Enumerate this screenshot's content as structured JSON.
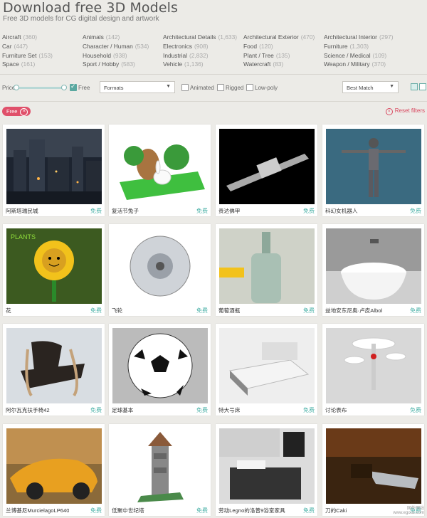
{
  "header": {
    "title": "Download free 3D Models",
    "subtitle": "Free 3D models for CG digital design and artwork"
  },
  "categories": [
    {
      "name": "Aircraft",
      "count": "(360)"
    },
    {
      "name": "Animals",
      "count": "(142)"
    },
    {
      "name": "Architectural Details",
      "count": "(1,633)"
    },
    {
      "name": "Architectural Exterior",
      "count": "(470)"
    },
    {
      "name": "Architectural Interior",
      "count": "(297)"
    },
    {
      "name": "Car",
      "count": "(447)"
    },
    {
      "name": "Character / Human",
      "count": "(534)"
    },
    {
      "name": "Electronics",
      "count": "(908)"
    },
    {
      "name": "Food",
      "count": "(120)"
    },
    {
      "name": "Furniture",
      "count": "(1,303)"
    },
    {
      "name": "Furniture Set",
      "count": "(153)"
    },
    {
      "name": "Household",
      "count": "(938)"
    },
    {
      "name": "Industrial",
      "count": "(2,832)"
    },
    {
      "name": "Plant / Tree",
      "count": "(135)"
    },
    {
      "name": "Science / Medical",
      "count": "(109)"
    },
    {
      "name": "Space",
      "count": "(161)"
    },
    {
      "name": "Sport / Hobby",
      "count": "(583)"
    },
    {
      "name": "Vehicle",
      "count": "(1,136)"
    },
    {
      "name": "Watercraft",
      "count": "(83)"
    },
    {
      "name": "Weapon / Military",
      "count": "(370)"
    }
  ],
  "filters": {
    "price_label": "Price",
    "free_label": "Free",
    "free_checked": true,
    "formats_label": "Formats",
    "animated_label": "Animated",
    "rigged_label": "Rigged",
    "lowpoly_label": "Low-poly",
    "sort_label": "Best Match"
  },
  "active_filters": {
    "tag": "Free",
    "reset_label": "Reset filters"
  },
  "cards": [
    {
      "name": "阿斯塔瑞民城",
      "price": "免费",
      "icon": "city-scene"
    },
    {
      "name": "复活节兔子",
      "price": "免费",
      "icon": "easter-bunny"
    },
    {
      "name": "贵达佛甲",
      "price": "免费",
      "icon": "linear-rail"
    },
    {
      "name": "科幻女机器人",
      "price": "免费",
      "icon": "robot-woman"
    },
    {
      "name": "花",
      "price": "免费",
      "icon": "sunflower"
    },
    {
      "name": "飞轮",
      "price": "免费",
      "icon": "flywheel"
    },
    {
      "name": "葡萄酒瓶",
      "price": "免费",
      "icon": "wine-bottle"
    },
    {
      "name": "益地安东尼奥·卢皮Albol",
      "price": "免费",
      "icon": "wash-basin"
    },
    {
      "name": "阿尔瓦克扶手椅42",
      "price": "免费",
      "icon": "armchair"
    },
    {
      "name": "足球基本",
      "price": "免费",
      "icon": "soccer-ball"
    },
    {
      "name": "特大号床",
      "price": "免费",
      "icon": "bed"
    },
    {
      "name": "讨论表布",
      "price": "免费",
      "icon": "bar-tables"
    },
    {
      "name": "兰博基尼MurcielagoLP640",
      "price": "免费",
      "icon": "sports-car"
    },
    {
      "name": "低聚中世纪塔",
      "price": "免费",
      "icon": "medieval-tower"
    },
    {
      "name": "劳动Legno的洛普9浴室家具",
      "price": "免费",
      "icon": "bathroom-furniture"
    },
    {
      "name": "刀的Caki",
      "price": "免费",
      "icon": "knife"
    }
  ],
  "watermark": {
    "line1": "国外网站",
    "line2": "www.egouz.com"
  }
}
